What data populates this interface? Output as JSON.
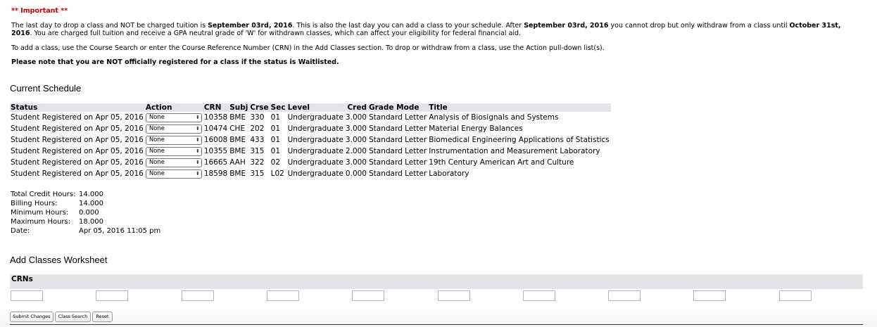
{
  "notice": {
    "important": "** Important **",
    "p1_a": "The last day to drop a class and NOT be charged tuition is ",
    "p1_b": "September 03rd, 2016",
    "p1_c": ". This is also the last day you can add a class to your schedule. After ",
    "p1_d": "September 03rd, 2016",
    "p1_e": " you cannot drop but only withdraw from a class until ",
    "p1_f": "October 31st, 2016",
    "p1_g": ". You are charged full tuition and receive a GPA neutral grade of 'W' for withdrawn classes, which can affect your eligibility for federal financial aid.",
    "p2": "To add a class, use the Course Search or enter the Course Reference Number (CRN) in the Add Classes section. To drop or withdraw from a class, use the Action pull-down list(s).",
    "p3": "Please note that you are NOT officially registered for a class if the status is Waitlisted."
  },
  "current_schedule": {
    "title": "Current Schedule",
    "headers": {
      "status": "Status",
      "action": "Action",
      "crn": "CRN",
      "subj": "Subj",
      "crse": "Crse",
      "sec": "Sec",
      "level": "Level",
      "cred": "Cred",
      "grade_mode": "Grade Mode",
      "title": "Title"
    },
    "rows": [
      {
        "status": "Student Registered on Apr 05, 2016",
        "action": "None",
        "crn": "10358",
        "subj": "BME",
        "crse": "330",
        "sec": "01",
        "level": "Undergraduate",
        "cred": "3.000",
        "grade_mode": "Standard Letter",
        "title": "Analysis of Biosignals and Systems"
      },
      {
        "status": "Student Registered on Apr 05, 2016",
        "action": "None",
        "crn": "10474",
        "subj": "CHE",
        "crse": "202",
        "sec": "01",
        "level": "Undergraduate",
        "cred": "3.000",
        "grade_mode": "Standard Letter",
        "title": "Material Energy Balances"
      },
      {
        "status": "Student Registered on Apr 05, 2016",
        "action": "None",
        "crn": "16008",
        "subj": "BME",
        "crse": "433",
        "sec": "01",
        "level": "Undergraduate",
        "cred": "3.000",
        "grade_mode": "Standard Letter",
        "title": "Biomedical Engineering Applications of Statistics"
      },
      {
        "status": "Student Registered on Apr 05, 2016",
        "action": "None",
        "crn": "10355",
        "subj": "BME",
        "crse": "315",
        "sec": "01",
        "level": "Undergraduate",
        "cred": "2.000",
        "grade_mode": "Standard Letter",
        "title": "Instrumentation and Measurement Laboratory"
      },
      {
        "status": "Student Registered on Apr 05, 2016",
        "action": "None",
        "crn": "16665",
        "subj": "AAH",
        "crse": "322",
        "sec": "02",
        "level": "Undergraduate",
        "cred": "3.000",
        "grade_mode": "Standard Letter",
        "title": "19th Century American Art and Culture"
      },
      {
        "status": "Student Registered on Apr 05, 2016",
        "action": "None",
        "crn": "18598",
        "subj": "BME",
        "crse": "315",
        "sec": "L02",
        "level": "Undergraduate",
        "cred": "0.000",
        "grade_mode": "Standard Letter",
        "title": "Laboratory"
      }
    ]
  },
  "totals": {
    "total_credit_label": "Total Credit Hours:",
    "total_credit_value": "14.000",
    "billing_label": "Billing Hours:",
    "billing_value": "14.000",
    "minimum_label": "Minimum Hours:",
    "minimum_value": "0.000",
    "maximum_label": "Maximum Hours:",
    "maximum_value": "18.000",
    "date_label": "Date:",
    "date_value": "Apr 05, 2016 11:05 pm"
  },
  "add_classes": {
    "title": "Add Classes Worksheet",
    "crns_label": "CRNs",
    "crn_values": [
      "",
      "",
      "",
      "",
      "",
      "",
      "",
      "",
      "",
      ""
    ]
  },
  "buttons": {
    "submit": "Submit Changes",
    "class_search": "Class Search",
    "reset": "Reset"
  }
}
